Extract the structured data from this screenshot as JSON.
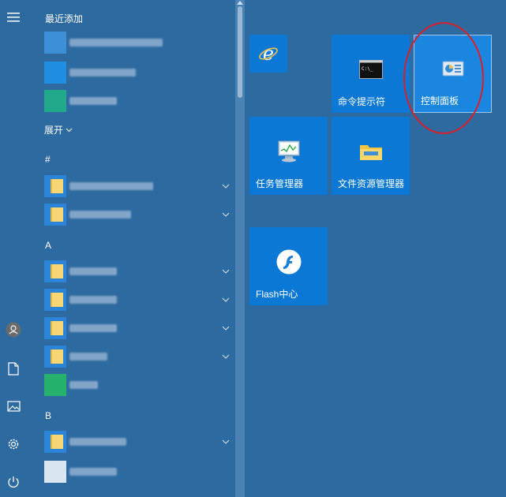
{
  "rail": {
    "menu_icon": "hamburger-icon",
    "user_icon": "user-avatar-icon",
    "documents_icon": "document-icon",
    "pictures_icon": "picture-icon",
    "settings_icon": "gear-icon",
    "power_icon": "power-icon"
  },
  "applist": {
    "recent_header": "最近添加",
    "expand_label": "展开",
    "sections": {
      "hash": "#",
      "a": "A",
      "b": "B"
    }
  },
  "tiles": {
    "ie": {
      "label": "",
      "icon": "internet-explorer-icon"
    },
    "cmd": {
      "label": "命令提示符",
      "icon": "command-prompt-icon"
    },
    "control_panel": {
      "label": "控制面板",
      "icon": "control-panel-icon"
    },
    "task_manager": {
      "label": "任务管理器",
      "icon": "task-manager-icon"
    },
    "file_explorer": {
      "label": "文件资源管理器",
      "icon": "folder-icon"
    },
    "flash": {
      "label": "Flash中心",
      "icon": "flash-icon"
    }
  },
  "colors": {
    "background": "#2d6aa0",
    "tile": "#0a78d4",
    "highlight": "#d8202a"
  }
}
